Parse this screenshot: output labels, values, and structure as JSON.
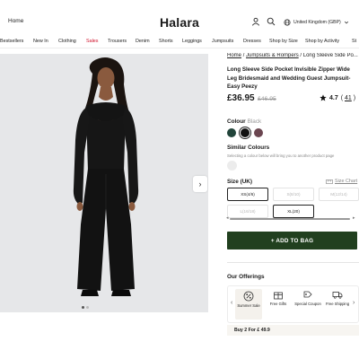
{
  "header": {
    "home": "Home",
    "logo": "Halara",
    "region": "United Kingdom (GBP)"
  },
  "icons": {
    "account": "user-icon",
    "search": "search-icon",
    "globe": "globe-icon",
    "chevron": "chevron-down-icon"
  },
  "nav": {
    "items": [
      "Bestsellers",
      "New In",
      "Clothing",
      "Sales",
      "Trousers",
      "Denim",
      "Shorts",
      "Leggings",
      "Jumpsuits",
      "Dresses",
      "Shop by Size",
      "Shop by Activity",
      "St"
    ],
    "sale_color": "#d0112b"
  },
  "gallery": {
    "active_dot": 1,
    "dot_count": 2
  },
  "product": {
    "breadcrumb": [
      "Home",
      "Jumpsuits & Rompers",
      "Long Sleeve Side Po..."
    ],
    "title": "Long Sleeve Side Pocket Invisible Zipper Wide Leg Bridesmaid and Wedding Guest Jumpsuit-Easy Peezy",
    "price": "£36.95",
    "old_price": "£46.95",
    "rating": "4.7",
    "review_count": "41",
    "colour_label": "Colour",
    "colour_value": "Black",
    "swatches": [
      "#21443a",
      "#111111",
      "#6b4650"
    ],
    "selected_swatch": 1,
    "similar_label": "Similar Colours",
    "similar_hint": "Selecting a colour below will bring you to another product page",
    "size_label": "Size (UK)",
    "size_chart": "Size Chart",
    "sizes": [
      {
        "label": "XS(4/6)",
        "state": "selected"
      },
      {
        "label": "S(8/10)",
        "state": "disabled"
      },
      {
        "label": "M(12/14)",
        "state": "disabled"
      },
      {
        "label": "L(16/18)",
        "state": "disabled"
      },
      {
        "label": "XL(20)",
        "state": "selected"
      }
    ],
    "add_to_bag": "+ ADD TO BAG",
    "accent": "#21401f"
  },
  "offerings": {
    "title": "Our Offerings",
    "items": [
      "Summer Sale",
      "Free Gifts",
      "Special Coupon",
      "Free Shipping"
    ],
    "promo": "Buy 2 For £ 49.9"
  }
}
